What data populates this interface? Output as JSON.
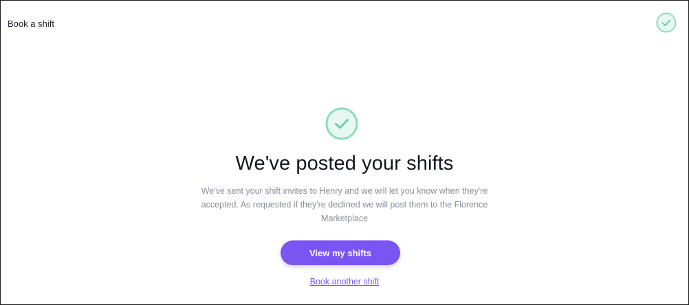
{
  "header": {
    "title": "Book a shift",
    "status_icon": "check-circle-icon"
  },
  "confirmation": {
    "icon": "check-circle-icon",
    "heading": "We've posted your shifts",
    "message": "We've sent your shift invites to Henry and we will let you know when they're accepted. As requested if they're declined we will post them to the Florence Marketplace"
  },
  "actions": {
    "primary_label": "View my shifts",
    "secondary_label": "Book another shift"
  },
  "colors": {
    "accent": "#7b55f1",
    "success": "#8fdcbb",
    "success_fill": "#e7f8f0",
    "text": "#14161f",
    "muted": "#8a8d99"
  }
}
